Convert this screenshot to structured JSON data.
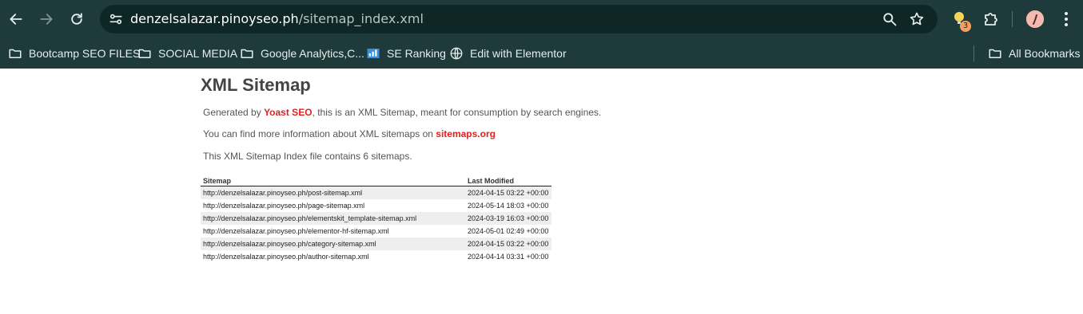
{
  "browser": {
    "url_host": "denzelsalazar.pinoyseo.ph",
    "url_path": "/sitemap_index.xml",
    "extension_badge": "3",
    "bookmarks": [
      {
        "label": "Bootcamp SEO FILES",
        "icon": "folder-icon"
      },
      {
        "label": "SOCIAL MEDIA",
        "icon": "folder-icon"
      },
      {
        "label": "Google Analytics,C...",
        "icon": "folder-icon"
      },
      {
        "label": "SE Ranking",
        "icon": "bar-chart-icon"
      },
      {
        "label": "Edit with Elementor",
        "icon": "globe-icon"
      }
    ],
    "all_bookmarks": "All Bookmarks"
  },
  "page": {
    "title": "XML Sitemap",
    "generated_prefix": "Generated by ",
    "generated_link": "Yoast SEO",
    "generated_suffix": ", this is an XML Sitemap, meant for consumption by search engines.",
    "info_prefix": "You can find more information about XML sitemaps on ",
    "info_link": "sitemaps.org",
    "index_note": "This XML Sitemap Index file contains 6 sitemaps.",
    "table": {
      "headers": [
        "Sitemap",
        "Last Modified"
      ],
      "rows": [
        {
          "url": "http://denzelsalazar.pinoyseo.ph/post-sitemap.xml",
          "modified": "2024-04-15 03:22 +00:00"
        },
        {
          "url": "http://denzelsalazar.pinoyseo.ph/page-sitemap.xml",
          "modified": "2024-05-14 18:03 +00:00"
        },
        {
          "url": "http://denzelsalazar.pinoyseo.ph/elementskit_template-sitemap.xml",
          "modified": "2024-03-19 16:03 +00:00"
        },
        {
          "url": "http://denzelsalazar.pinoyseo.ph/elementor-hf-sitemap.xml",
          "modified": "2024-05-01 02:49 +00:00"
        },
        {
          "url": "http://denzelsalazar.pinoyseo.ph/category-sitemap.xml",
          "modified": "2024-04-15 03:22 +00:00"
        },
        {
          "url": "http://denzelsalazar.pinoyseo.ph/author-sitemap.xml",
          "modified": "2024-04-14 03:31 +00:00"
        }
      ]
    }
  },
  "colors": {
    "chrome_bg": "#1f3a3a",
    "link_red": "#dd2222"
  }
}
